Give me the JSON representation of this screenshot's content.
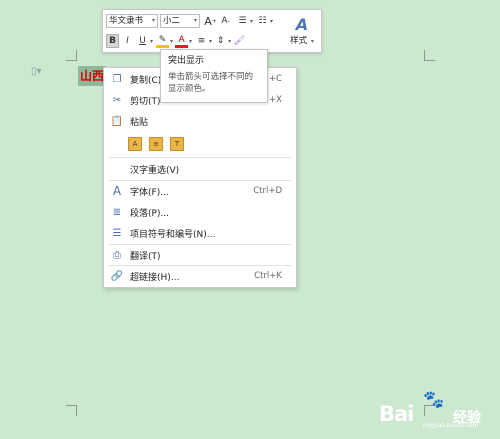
{
  "document": {
    "selected_text": "山西",
    "handle_icon": "paragraph-handle-icon"
  },
  "mini_toolbar": {
    "font_name": "华文隶书",
    "font_size": "小二",
    "grow_font": "A",
    "shrink_font": "A",
    "bold": "B",
    "italic": "I",
    "underline": "U",
    "font_color": "A",
    "styles_label": "样式",
    "font_color_hex": "#e02020",
    "highlight_color_hex": "#f5c400"
  },
  "tooltip": {
    "title": "突出显示",
    "description": "单击箭头可选择不同的显示颜色。"
  },
  "context_menu": {
    "copy": {
      "label": "复制(C)",
      "shortcut": "+C"
    },
    "cut": {
      "label": "剪切(T)",
      "shortcut": "+X"
    },
    "paste": {
      "label": "粘贴"
    },
    "hanzi_reselect": {
      "label": "汉字重选(V)"
    },
    "font": {
      "label": "字体(F)...",
      "shortcut": "Ctrl+D"
    },
    "paragraph": {
      "label": "段落(P)..."
    },
    "bullets": {
      "label": "项目符号和编号(N)..."
    },
    "translate": {
      "label": "翻译(T)"
    },
    "hyperlink": {
      "label": "超链接(H)...",
      "shortcut": "Ctrl+K"
    }
  },
  "watermark": {
    "text": "Bai",
    "paw": "🐾",
    "suffix": "经验",
    "url": "jingyan.baidu.com"
  }
}
